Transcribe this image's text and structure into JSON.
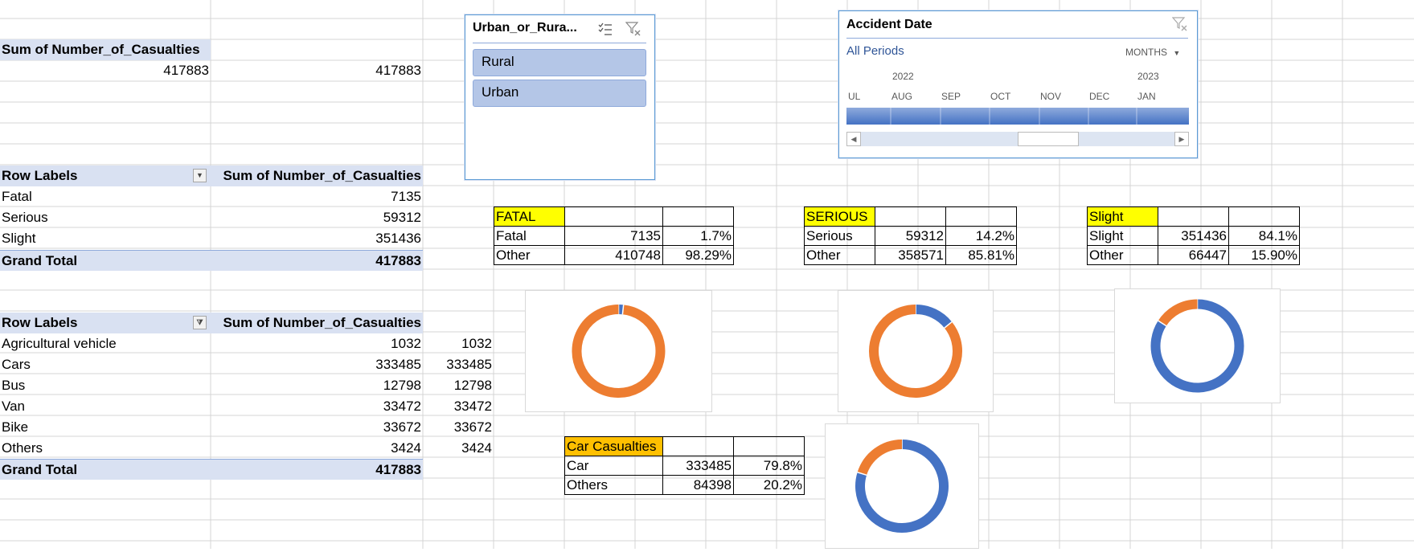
{
  "colors": {
    "pivot_header": "#d9e1f2",
    "highlight_yellow": "#ffff00",
    "highlight_orange": "#ffc000",
    "slicer_item": "#b4c6e7",
    "donut_blue": "#4472c4",
    "donut_orange": "#ed7d31"
  },
  "pivot_total": {
    "header": "Sum of Number_of_Casualties",
    "value": "417883",
    "copy_value": "417883"
  },
  "severity_pivot": {
    "row_labels_header": "Row Labels",
    "sum_header": "Sum of Number_of_Casualties",
    "rows": [
      {
        "label": "Fatal",
        "value": "7135"
      },
      {
        "label": "Serious",
        "value": "59312"
      },
      {
        "label": "Slight",
        "value": "351436"
      }
    ],
    "grand_total_label": "Grand Total",
    "grand_total_value": "417883"
  },
  "vehicle_pivot": {
    "row_labels_header": "Row Labels",
    "sum_header": "Sum of Number_of_Casualties",
    "rows": [
      {
        "label": "Agricultural vehicle",
        "value": "1032",
        "copy": "1032"
      },
      {
        "label": "Cars",
        "value": "333485",
        "copy": "333485"
      },
      {
        "label": "Bus",
        "value": "12798",
        "copy": "12798"
      },
      {
        "label": "Van",
        "value": "33472",
        "copy": "33472"
      },
      {
        "label": "Bike",
        "value": "33672",
        "copy": "33672"
      },
      {
        "label": "Others",
        "value": "3424",
        "copy": "3424"
      }
    ],
    "grand_total_label": "Grand Total",
    "grand_total_value": "417883"
  },
  "fatal_table": {
    "title": "FATAL",
    "rows": [
      {
        "label": "Fatal",
        "value": "7135",
        "pct": "1.7%"
      },
      {
        "label": "Other",
        "value": "410748",
        "pct": "98.29%"
      }
    ]
  },
  "serious_table": {
    "title": "SERIOUS",
    "rows": [
      {
        "label": "Serious",
        "value": "59312",
        "pct": "14.2%"
      },
      {
        "label": "Other",
        "value": "358571",
        "pct": "85.81%"
      }
    ]
  },
  "slight_table": {
    "title": "Slight",
    "rows": [
      {
        "label": "Slight",
        "value": "351436",
        "pct": "84.1%"
      },
      {
        "label": "Other",
        "value": "66447",
        "pct": "15.90%"
      }
    ]
  },
  "car_table": {
    "title": "Car Casualties",
    "rows": [
      {
        "label": "Car",
        "value": "333485",
        "pct": "79.8%"
      },
      {
        "label": "Others",
        "value": "84398",
        "pct": "20.2%"
      }
    ]
  },
  "slicer": {
    "title": "Urban_or_Rura...",
    "items": [
      "Rural",
      "Urban"
    ],
    "icons": [
      "multi-select-icon",
      "clear-filter-icon"
    ]
  },
  "timeline": {
    "title": "Accident Date",
    "period_label": "All Periods",
    "unit_label": "MONTHS",
    "years": [
      "2022",
      "2023"
    ],
    "months": [
      "UL",
      "AUG",
      "SEP",
      "OCT",
      "NOV",
      "DEC",
      "JAN"
    ]
  },
  "donuts": [
    {
      "name": "fatal",
      "blue_fraction": 0.017,
      "blue_start": 0,
      "blue_first": true
    },
    {
      "name": "serious",
      "blue_fraction": 0.142,
      "blue_first": true
    },
    {
      "name": "slight",
      "blue_fraction": 0.841,
      "blue_first": false
    },
    {
      "name": "car",
      "blue_fraction": 0.798,
      "blue_first": false
    }
  ]
}
